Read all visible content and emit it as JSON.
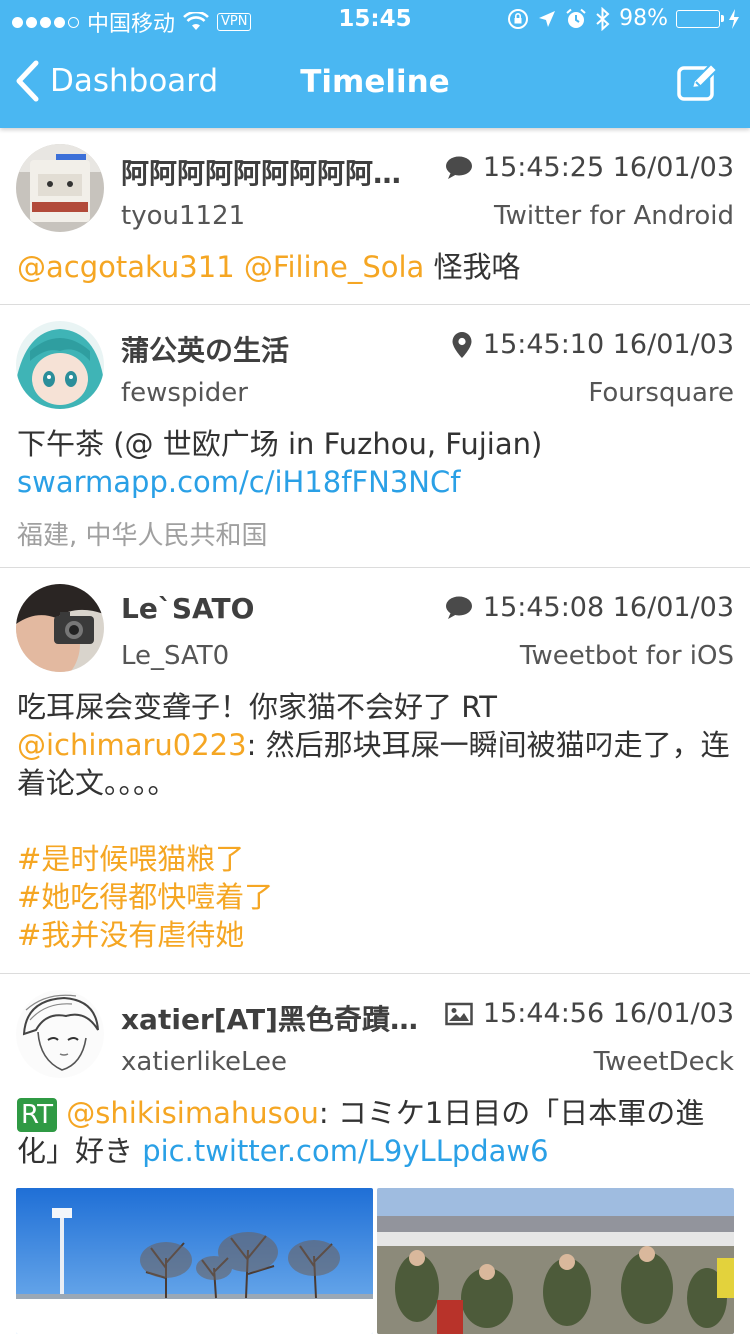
{
  "status_bar": {
    "carrier": "中国移动",
    "vpn": "VPN",
    "time": "15:45",
    "battery": "98%",
    "battery_level": 0.98
  },
  "nav": {
    "back_label": "Dashboard",
    "title": "Timeline"
  },
  "tweets": [
    {
      "name": "阿阿阿阿阿阿阿阿阿…",
      "handle": "tyou1121",
      "timestamp": "15:45:25 16/01/03",
      "client": "Twitter for Android",
      "indicator": "speech-bubble-icon",
      "body": {
        "mention1": "@acgotaku311",
        "mention2": "@Filine_Sola",
        "text": " 怪我咯"
      }
    },
    {
      "name": "蒲公英の生活",
      "handle": "fewspider",
      "timestamp": "15:45:10 16/01/03",
      "client": "Foursquare",
      "indicator": "location-pin-icon",
      "body": {
        "line1": "下午茶 (@ 世欧广场 in Fuzhou, Fujian)",
        "link": "swarmapp.com/c/iH18fFN3NCf"
      },
      "location": "福建, 中华人民共和国"
    },
    {
      "name": "Le`SATO",
      "handle": "Le_SAT0",
      "timestamp": "15:45:08 16/01/03",
      "client": "Tweetbot for iOS",
      "indicator": "speech-bubble-icon",
      "body": {
        "text1": "吃耳屎会变聋子！你家猫不会好了 RT",
        "mention": "@ichimaru0223",
        "text2": ": 然后那块耳屎一瞬间被猫叼走了，连着论文。。。。",
        "hashtags": [
          "#是时候喂猫粮了",
          "#她吃得都快噎着了",
          "#我并没有虐待她"
        ]
      }
    },
    {
      "name": "xatier[AT]黑色奇蹟←…",
      "handle": "xatierlikeLee",
      "timestamp": "15:44:56 16/01/03",
      "client": "TweetDeck",
      "indicator": "image-icon",
      "body": {
        "rt": "RT",
        "mention": "@shikisimahusou",
        "text": ": コミケ1日目の「日本軍の進化」好き ",
        "link": "pic.twitter.com/L9yLLpdaw6"
      }
    }
  ],
  "colors": {
    "nav_bg": "#4ab7f2",
    "mention": "#f5a623",
    "link": "#2aa0e6",
    "rt_badge": "#2f9a44",
    "battery": "#4cd964"
  }
}
